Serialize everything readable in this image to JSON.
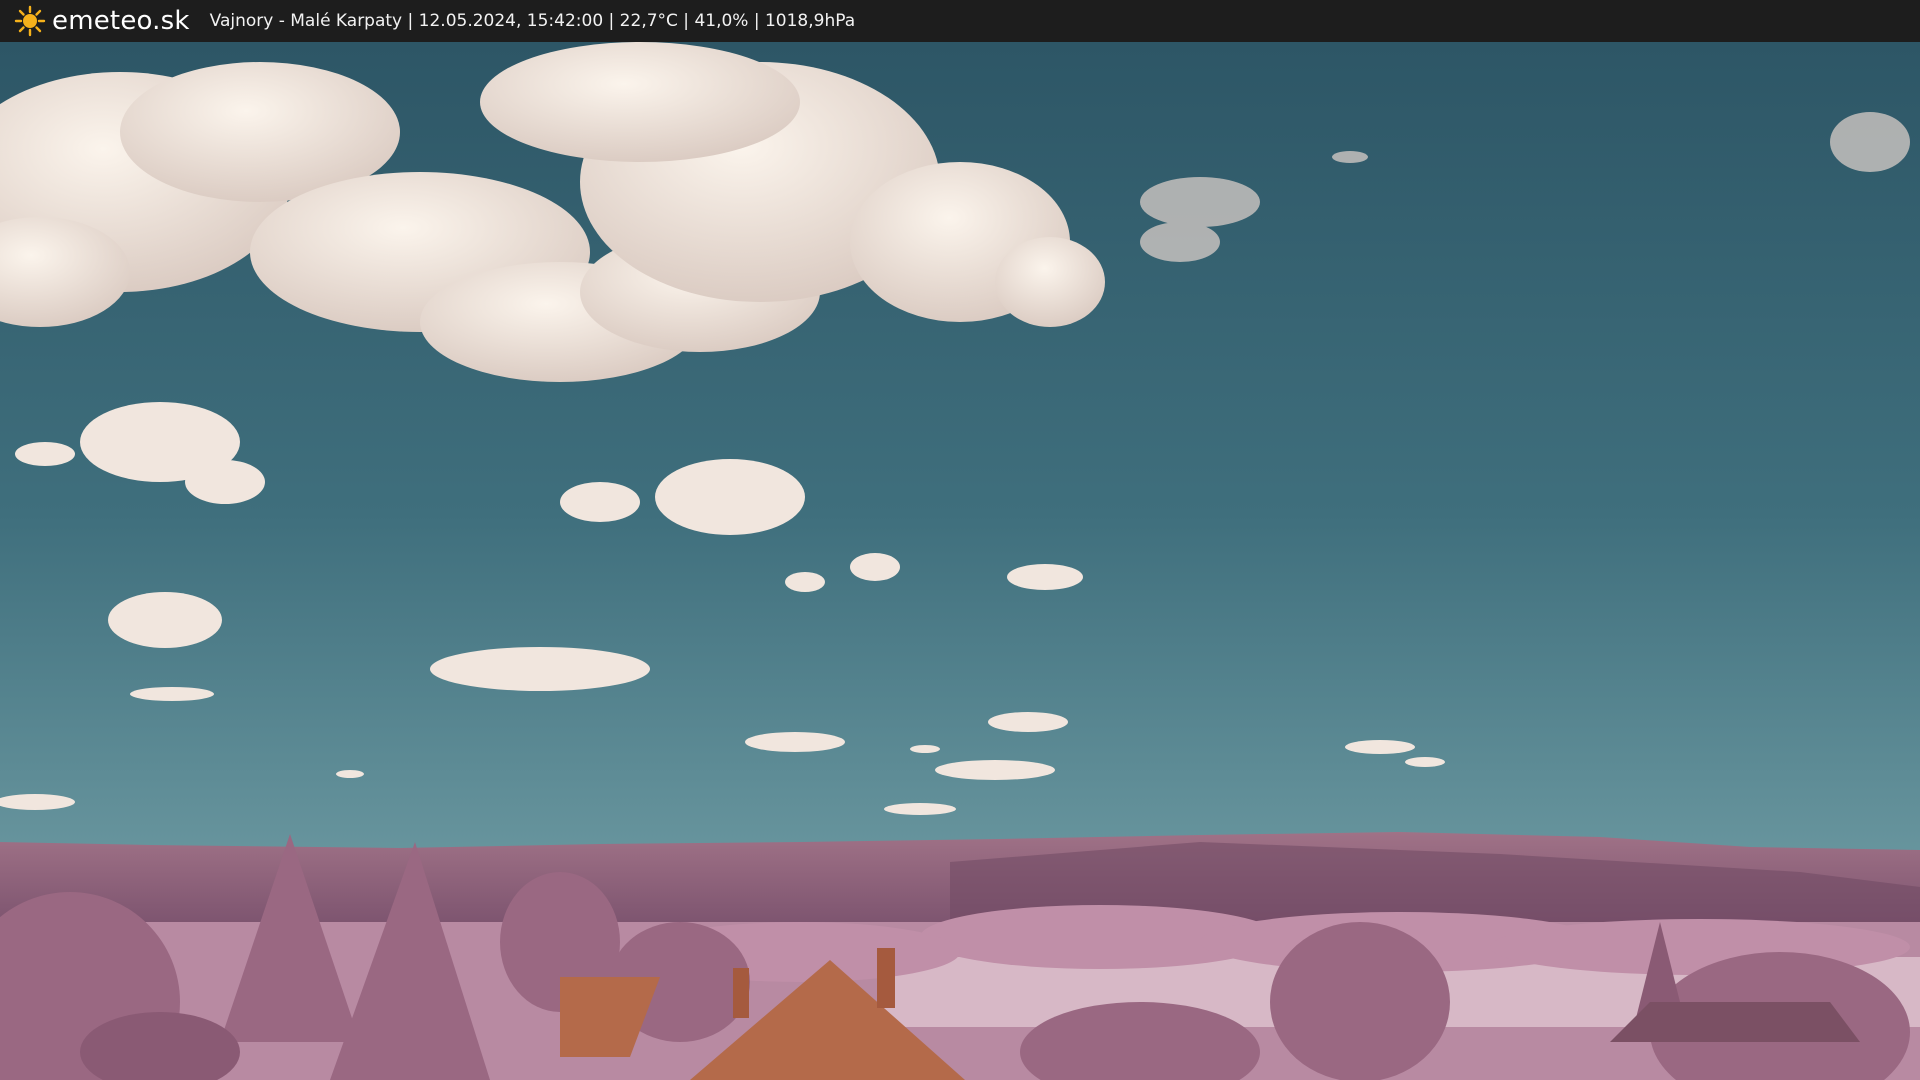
{
  "header": {
    "brand": "emeteo.sk",
    "logo_icon": "sun-icon",
    "station": "Vajnory - Malé Karpaty",
    "timestamp": "12.05.2024, 15:42:00",
    "temperature": "22,7°C",
    "humidity": "41,0%",
    "pressure": "1018,9hPa",
    "meta_line": "Vajnory - Malé Karpaty | 12.05.2024, 15:42:00 | 22,7°C | 41,0% | 1018,9hPa"
  },
  "colors": {
    "bar_bg": "#1d1d1d",
    "sky_top": "#2f5868",
    "sky_bottom": "#5e8c96",
    "cloud": "#f3e8e0",
    "hills": "#9a6c86",
    "foliage": "#b07a98",
    "roof": "#b46a4a",
    "sun": "#f6b21b"
  }
}
